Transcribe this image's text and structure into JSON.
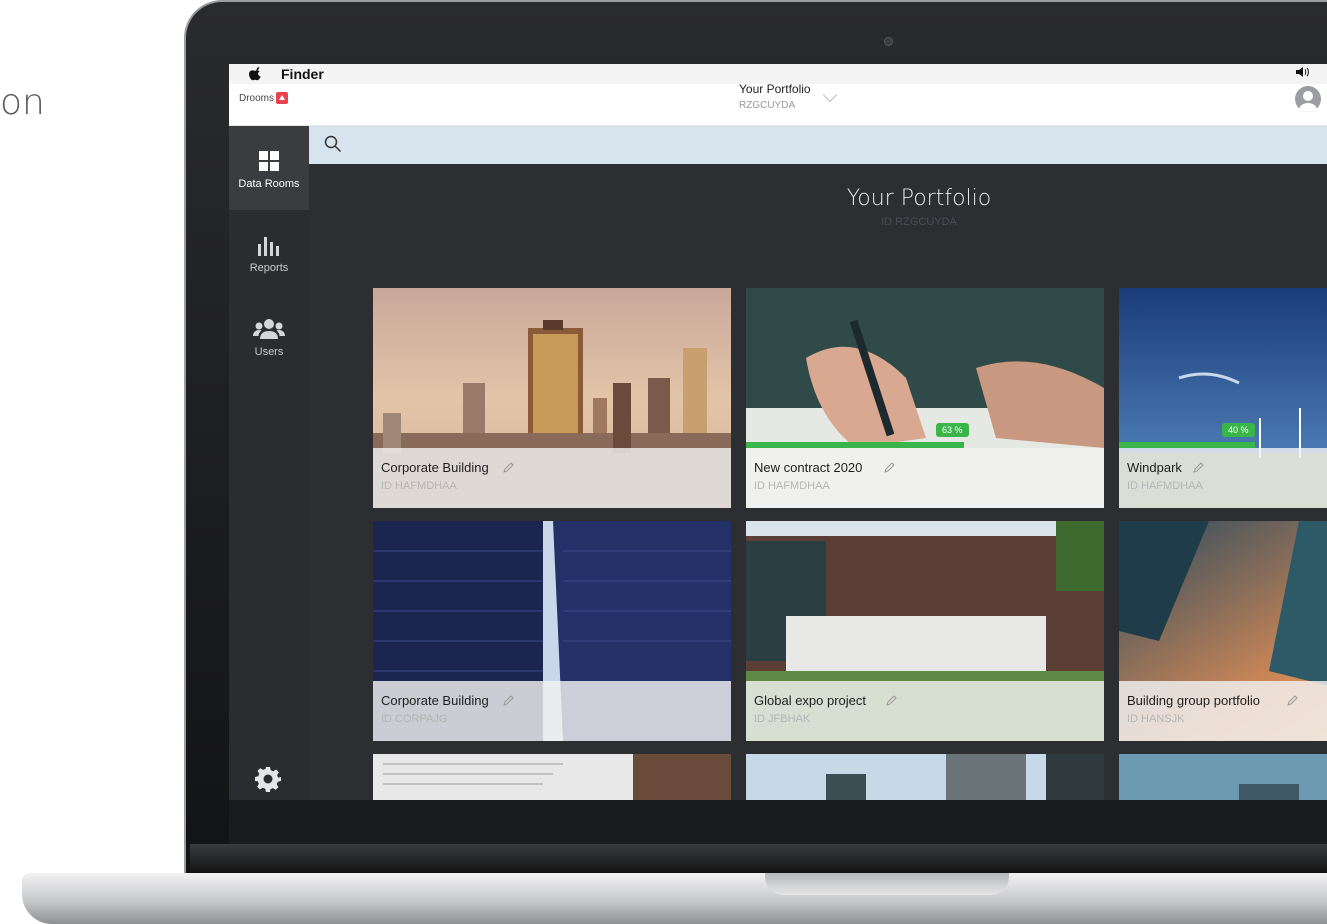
{
  "side_text": "on",
  "menubar": {
    "app_name": "Finder"
  },
  "header": {
    "logo": "Drooms",
    "portfolio_name": "Your Portfolio",
    "portfolio_id": "RZGCUYDA"
  },
  "sidebar": {
    "items": [
      {
        "label": "Data Rooms",
        "icon": "grid-icon"
      },
      {
        "label": "Reports",
        "icon": "bar-chart-icon"
      },
      {
        "label": "Users",
        "icon": "users-icon"
      }
    ],
    "settings_icon": "gear-icon"
  },
  "search": {
    "placeholder": ""
  },
  "main": {
    "title": "Your Portfolio",
    "subtitle": "ID RZGCUYDA",
    "cards": [
      {
        "title": "Corporate Building",
        "id": "ID HAFMDHAA",
        "image": "city-skyline"
      },
      {
        "title": "New contract 2020",
        "id": "ID HAFMDHAA",
        "image": "signing-contract",
        "progress": 63,
        "progress_label": "63 %"
      },
      {
        "title": "Windpark",
        "id": "ID HAFMDHAA",
        "image": "wind-turbines",
        "progress": 40,
        "progress_label": "40 %"
      },
      {
        "title": "Corporate Building",
        "id": "ID CORPAJG",
        "image": "glass-towers"
      },
      {
        "title": "Global expo project",
        "id": "ID JFBHAK",
        "image": "brick-building"
      },
      {
        "title": "Building group portfolio",
        "id": "ID HANSJK",
        "image": "skyscraper-sunset"
      }
    ]
  },
  "colors": {
    "accent_green": "#39b54a",
    "sidebar_bg": "#2a2c2f",
    "search_bg": "#d7e4ee",
    "brand_red": "#e94150"
  }
}
